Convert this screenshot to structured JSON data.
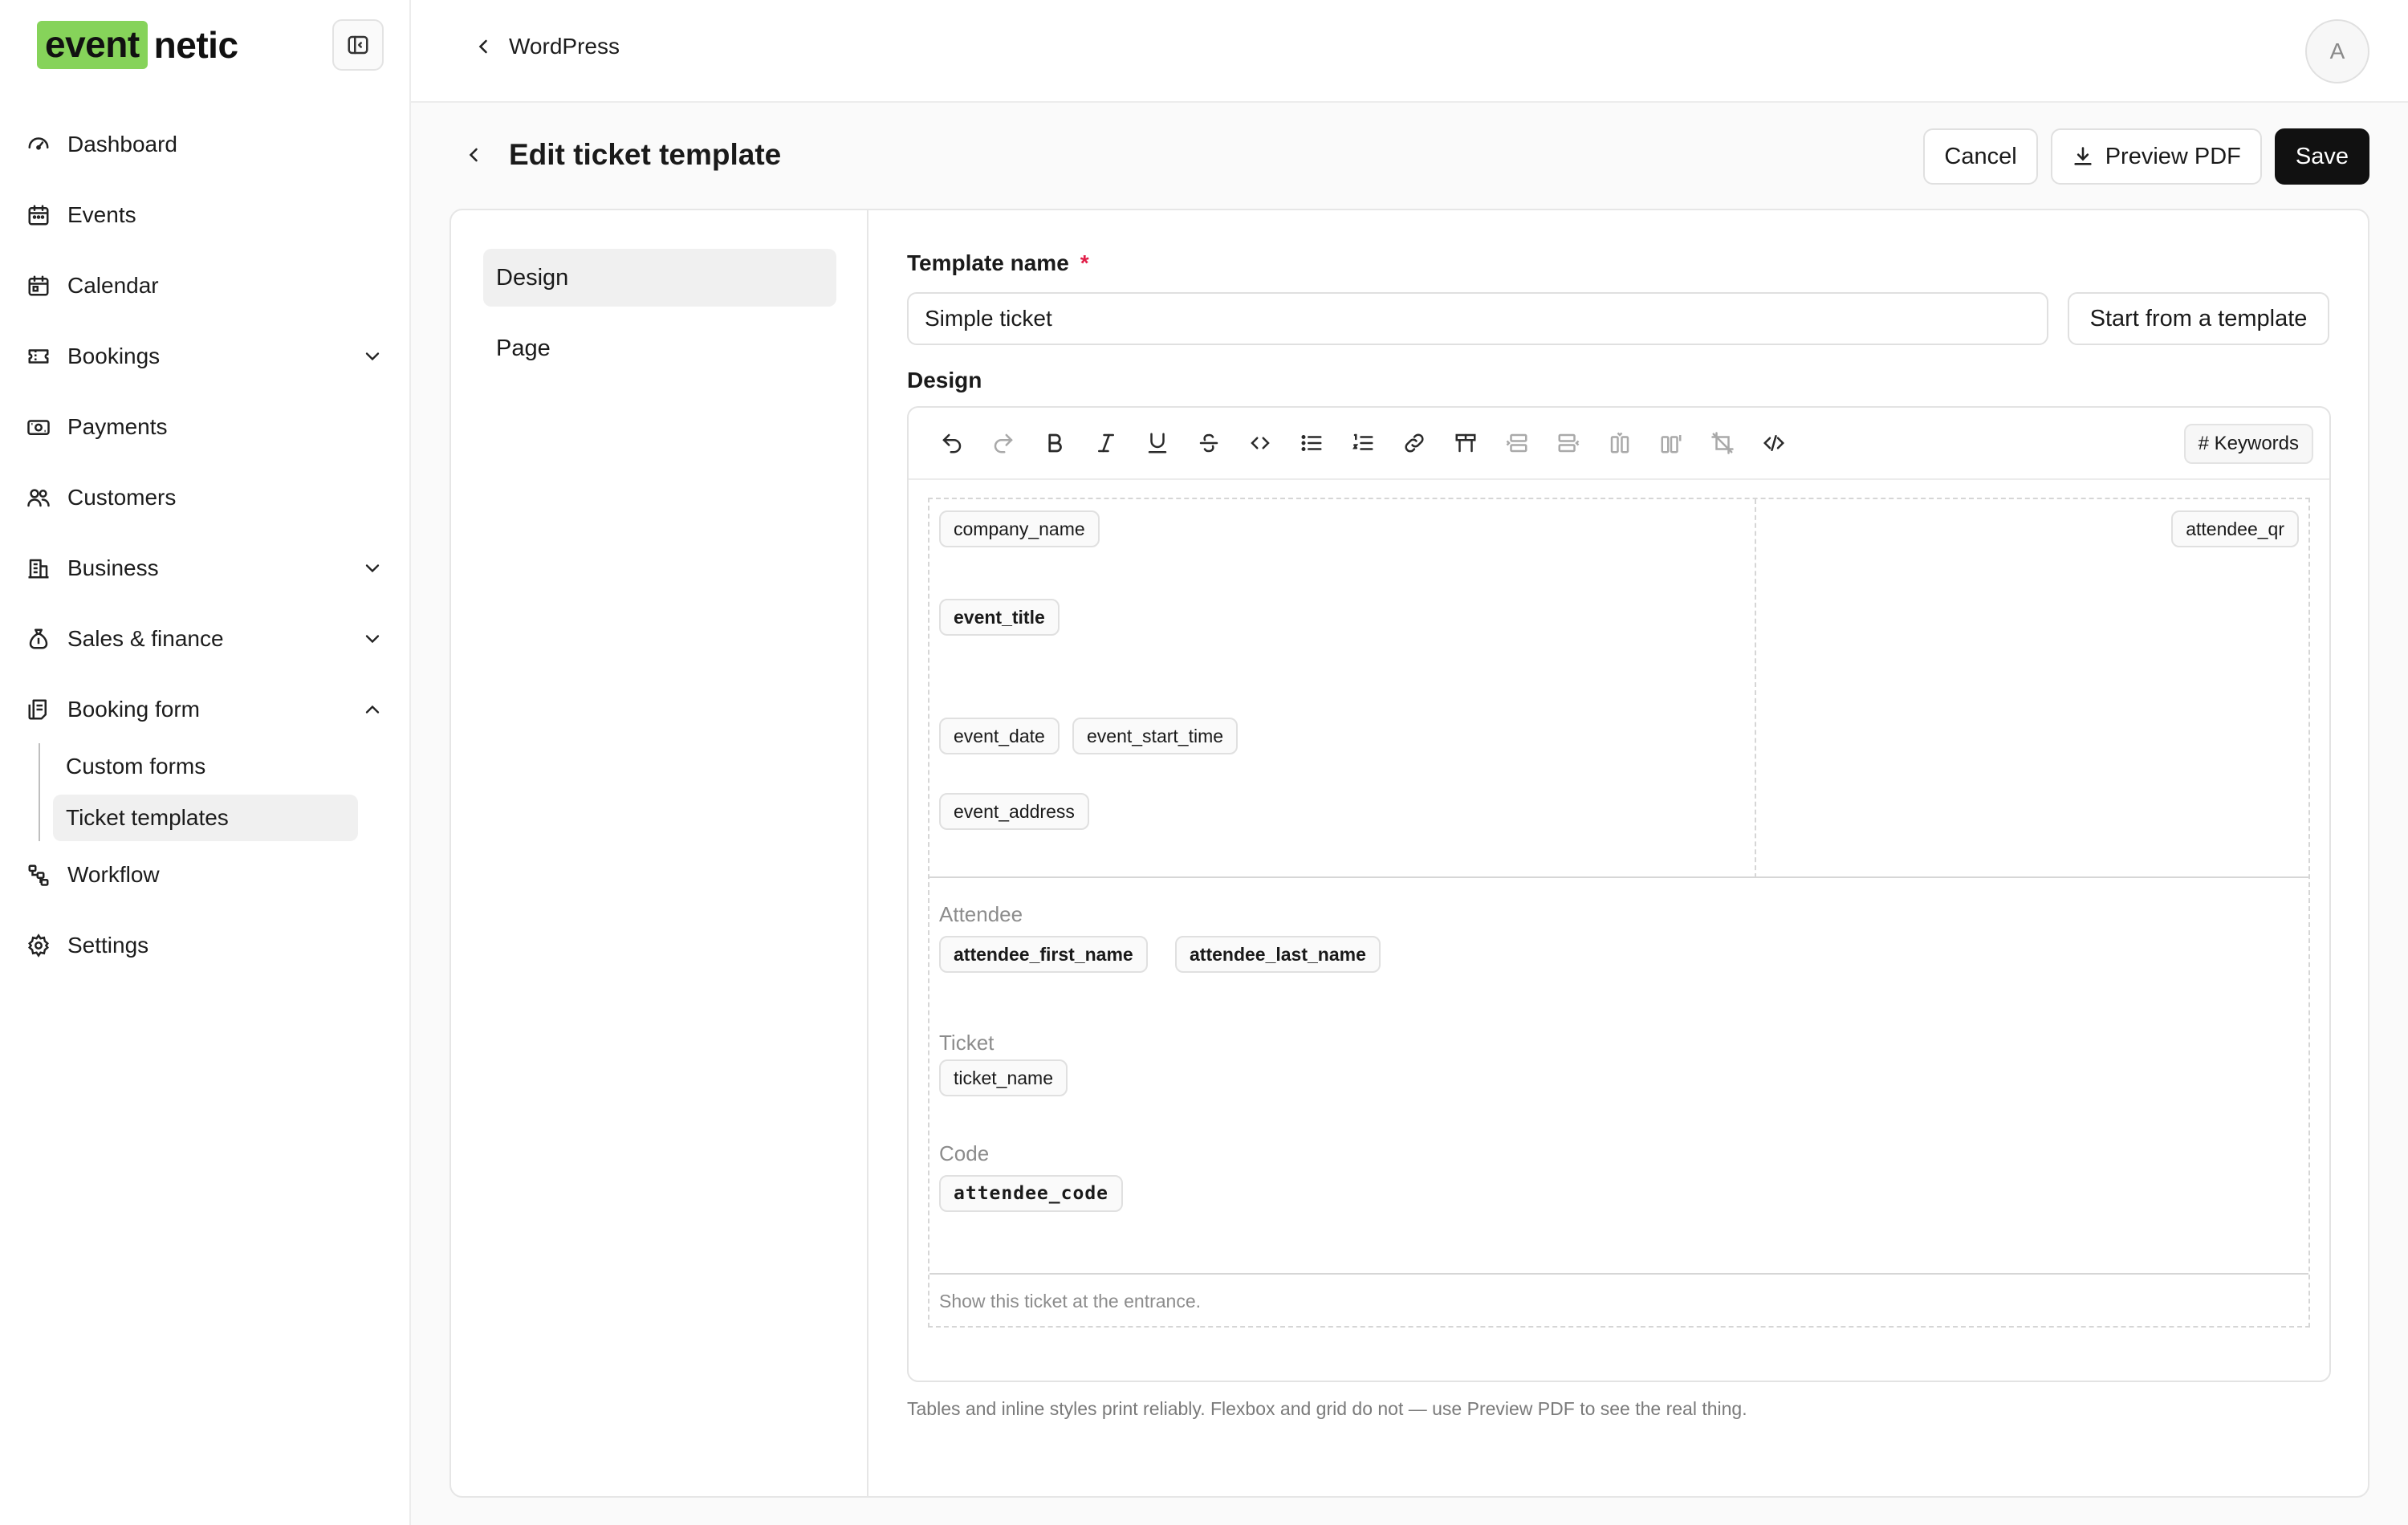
{
  "sidebar": {
    "logo_highlight": "event",
    "logo_rest": "netic",
    "items": [
      {
        "label": "Dashboard",
        "icon": "gauge-icon"
      },
      {
        "label": "Events",
        "icon": "calendar-event-icon"
      },
      {
        "label": "Calendar",
        "icon": "calendar-icon"
      },
      {
        "label": "Bookings",
        "icon": "ticket-icon",
        "expandable": true,
        "expanded": false
      },
      {
        "label": "Payments",
        "icon": "banknote-icon"
      },
      {
        "label": "Customers",
        "icon": "users-icon"
      },
      {
        "label": "Business",
        "icon": "building-icon",
        "expandable": true,
        "expanded": false
      },
      {
        "label": "Sales & finance",
        "icon": "money-bag-icon",
        "expandable": true,
        "expanded": false
      },
      {
        "label": "Booking form",
        "icon": "form-icon",
        "expandable": true,
        "expanded": true
      },
      {
        "label": "Workflow",
        "icon": "workflow-icon"
      },
      {
        "label": "Settings",
        "icon": "gear-icon"
      }
    ],
    "booking_form_children": [
      {
        "label": "Custom forms",
        "active": false
      },
      {
        "label": "Ticket templates",
        "active": true
      }
    ]
  },
  "topbar": {
    "breadcrumb": "WordPress",
    "avatar_initial": "A"
  },
  "page": {
    "title": "Edit ticket template",
    "cancel_label": "Cancel",
    "preview_label": "Preview PDF",
    "save_label": "Save"
  },
  "tabs": [
    {
      "label": "Design",
      "active": true
    },
    {
      "label": "Page",
      "active": false
    }
  ],
  "form": {
    "template_name_label": "Template name",
    "required_mark": "*",
    "template_name_value": "Simple ticket",
    "start_template_label": "Start from a template",
    "design_label": "Design",
    "keywords_label": "# Keywords",
    "hint": "Tables and inline styles print reliably. Flexbox and grid do not — use Preview PDF to see the real thing."
  },
  "toolbar": [
    {
      "name": "undo-icon",
      "dim": false
    },
    {
      "name": "redo-icon",
      "dim": true
    },
    {
      "name": "bold-icon",
      "dim": false
    },
    {
      "name": "italic-icon",
      "dim": false
    },
    {
      "name": "underline-icon",
      "dim": false
    },
    {
      "name": "strikethrough-icon",
      "dim": false
    },
    {
      "name": "code-icon",
      "dim": false
    },
    {
      "name": "bullet-list-icon",
      "dim": false
    },
    {
      "name": "numbered-list-icon",
      "dim": false
    },
    {
      "name": "link-icon",
      "dim": false
    },
    {
      "name": "table-icon",
      "dim": false
    },
    {
      "name": "insert-row-before-icon",
      "dim": true
    },
    {
      "name": "insert-row-after-icon",
      "dim": true
    },
    {
      "name": "insert-column-before-icon",
      "dim": true
    },
    {
      "name": "insert-column-after-icon",
      "dim": true
    },
    {
      "name": "delete-table-icon",
      "dim": true
    },
    {
      "name": "source-code-icon",
      "dim": false
    }
  ],
  "canvas": {
    "company_name": "company_name",
    "event_title": "event_title",
    "event_date": "event_date",
    "event_start_time": "event_start_time",
    "event_address": "event_address",
    "attendee_qr": "attendee_qr",
    "attendee_label": "Attendee",
    "attendee_first_name": "attendee_first_name",
    "attendee_last_name": "attendee_last_name",
    "ticket_label": "Ticket",
    "ticket_name": "ticket_name",
    "code_label": "Code",
    "attendee_code": "attendee_code",
    "footer_text": "Show this ticket at the entrance."
  }
}
